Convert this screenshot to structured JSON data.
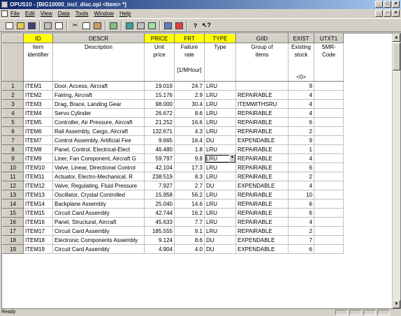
{
  "window": {
    "title": "OPUS10 - [BIG10000_incl_disc.opi <Item> *]"
  },
  "menu": [
    "File",
    "Edit",
    "View",
    "Data",
    "Tools",
    "Window",
    "Help"
  ],
  "columns": [
    {
      "id": "ID",
      "line1": "Item",
      "line2": "identifier",
      "line3": "",
      "line4": "",
      "line5": ""
    },
    {
      "id": "DESCR",
      "line1": "Description",
      "line2": "",
      "line3": "",
      "line4": "",
      "line5": ""
    },
    {
      "id": "PRICE",
      "line1": "Unit",
      "line2": "price",
      "line3": "",
      "line4": "",
      "line5": ""
    },
    {
      "id": "FRT",
      "line1": "Failure",
      "line2": "rate",
      "line3": "",
      "line4": "[1/MHour]",
      "line5": ""
    },
    {
      "id": "TYPE",
      "line1": "Type",
      "line2": "",
      "line3": "",
      "line4": "",
      "line5": ""
    },
    {
      "id": "GIID",
      "line1": "Group of",
      "line2": "items",
      "line3": "",
      "line4": "",
      "line5": ""
    },
    {
      "id": "EXIST",
      "line1": "Existing",
      "line2": "stock",
      "line3": "",
      "line4": "",
      "line5": "<0>"
    },
    {
      "id": "UTXT1",
      "line1": "SMR-",
      "line2": "Code",
      "line3": "",
      "line4": "",
      "line5": ""
    }
  ],
  "highlight_color": "#ffff00",
  "rows": [
    {
      "n": "1",
      "id": "ITEM1",
      "descr": "Door, Access, Aircraft",
      "price": "19.019",
      "frt": "24.7",
      "type": "LRU",
      "giid": "",
      "exist": "9",
      "utxt1": ""
    },
    {
      "n": "2",
      "id": "ITEM2",
      "descr": "Fairing, Aircraft",
      "price": "15.176",
      "frt": "2.9",
      "type": "LRU",
      "giid": "REPAIRABLE",
      "exist": "4",
      "utxt1": ""
    },
    {
      "n": "3",
      "id": "ITEM3",
      "descr": "Drag, Brace, Landing Gear",
      "price": "98.000",
      "frt": "30.4",
      "type": "LRU",
      "giid": "ITEMWITHSRU",
      "exist": "4",
      "utxt1": ""
    },
    {
      "n": "4",
      "id": "ITEM4",
      "descr": "Servo Cylinder",
      "price": "26.672",
      "frt": "8.6",
      "type": "LRU",
      "giid": "REPAIRABLE",
      "exist": "4",
      "utxt1": ""
    },
    {
      "n": "5",
      "id": "ITEM5",
      "descr": "Controller, Air Pressure, Aircraft",
      "price": "21.252",
      "frt": "16.6",
      "type": "LRU",
      "giid": "REPAIRABLE",
      "exist": "6",
      "utxt1": ""
    },
    {
      "n": "6",
      "id": "ITEM6",
      "descr": "Rail Assembly, Cargo, Aircraft",
      "price": "132.671",
      "frt": "4.3",
      "type": "LRU",
      "giid": "REPAIRABLE",
      "exist": "2",
      "utxt1": ""
    },
    {
      "n": "7",
      "id": "ITEM7",
      "descr": "Control Assembly, Artificial Fee",
      "price": "9.665",
      "frt": "16.4",
      "type": "DU",
      "giid": "EXPENDABLE",
      "exist": "9",
      "utxt1": ""
    },
    {
      "n": "8",
      "id": "ITEM8",
      "descr": "Panel, Control, Electrical-Elect",
      "price": "46.480",
      "frt": "1.8",
      "type": "LRU",
      "giid": "REPAIRABLE",
      "exist": "1",
      "utxt1": ""
    },
    {
      "n": "9",
      "id": "ITEM9",
      "descr": "Liner, Fan Component, Aircraft G",
      "price": "59.797",
      "frt": "9.8",
      "type": "LRU",
      "giid": "REPAIRABLE",
      "exist": "4",
      "utxt1": ""
    },
    {
      "n": "10",
      "id": "ITEM10",
      "descr": "Valve, Linear, Directional Control",
      "price": "42.104",
      "frt": "17.3",
      "type": "LRU",
      "giid": "REPAIRABLE",
      "exist": "6",
      "utxt1": ""
    },
    {
      "n": "11",
      "id": "ITEM11",
      "descr": "Actuator, Electro-Mechanical, R",
      "price": "238.519",
      "frt": "8.3",
      "type": "LRU",
      "giid": "REPAIRABLE",
      "exist": "2",
      "utxt1": ""
    },
    {
      "n": "12",
      "id": "ITEM12",
      "descr": "Valve, Regulating, Fluid Pressure",
      "price": "7.927",
      "frt": "2.7",
      "type": "DU",
      "giid": "EXPENDABLE",
      "exist": "4",
      "utxt1": ""
    },
    {
      "n": "13",
      "id": "ITEM13",
      "descr": "Oscillator, Crystal Controlled",
      "price": "15.958",
      "frt": "56.2",
      "type": "LRU",
      "giid": "REPAIRABLE",
      "exist": "10",
      "utxt1": ""
    },
    {
      "n": "14",
      "id": "ITEM14",
      "descr": "Backplane Assembly",
      "price": "25.040",
      "frt": "14.6",
      "type": "LRU",
      "giid": "REPAIRABLE",
      "exist": "6",
      "utxt1": ""
    },
    {
      "n": "15",
      "id": "ITEM15",
      "descr": "Circuit Card Assembly",
      "price": "42.744",
      "frt": "16.2",
      "type": "LRU",
      "giid": "REPAIRABLE",
      "exist": "6",
      "utxt1": ""
    },
    {
      "n": "16",
      "id": "ITEM16",
      "descr": "Panel, Structural, Aircraft",
      "price": "45.633",
      "frt": "7.7",
      "type": "LRU",
      "giid": "REPAIRABLE",
      "exist": "4",
      "utxt1": ""
    },
    {
      "n": "17",
      "id": "ITEM17",
      "descr": "Circuit Card Assembly",
      "price": "185.555",
      "frt": "9.1",
      "type": "LRU",
      "giid": "REPAIRABLE",
      "exist": "2",
      "utxt1": ""
    },
    {
      "n": "18",
      "id": "ITEM18",
      "descr": "Electronic Components Assembly",
      "price": "9.124",
      "frt": "8.6",
      "type": "DU",
      "giid": "EXPENDABLE",
      "exist": "7",
      "utxt1": ""
    },
    {
      "n": "19",
      "id": "ITEM19",
      "descr": "Circuit Card Assembly",
      "price": "4.904",
      "frt": "4.0",
      "type": "DU",
      "giid": "EXPENDABLE",
      "exist": "6",
      "utxt1": ""
    }
  ],
  "status": "Ready"
}
